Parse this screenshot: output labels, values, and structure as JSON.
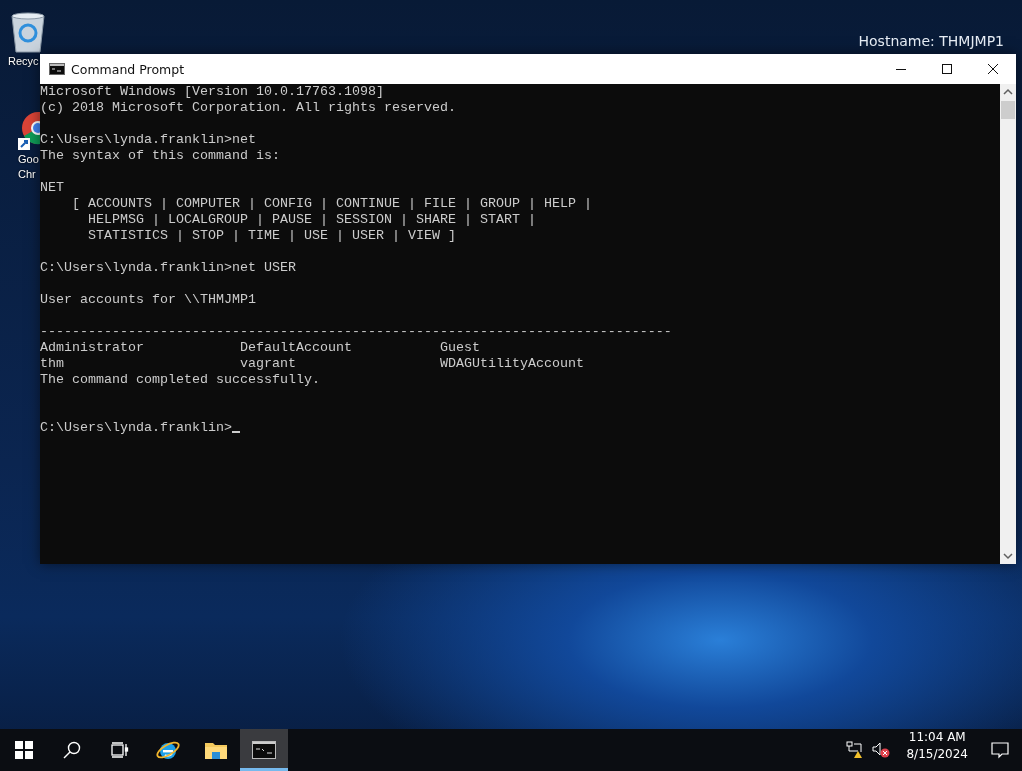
{
  "desktop": {
    "hostname": "Hostname: THMJMP1",
    "icons": [
      {
        "kind": "recycle",
        "label": "Recyc"
      },
      {
        "kind": "chrome",
        "label": "Goo",
        "label2": "Chr"
      }
    ]
  },
  "window": {
    "title": "Command Prompt",
    "blocks": [
      {
        "lines": [
          "Microsoft Windows [Version 10.0.17763.1098]",
          "(c) 2018 Microsoft Corporation. All rights reserved."
        ]
      },
      {
        "lines": [
          "C:\\Users\\lynda.franklin>net",
          "The syntax of this command is:"
        ]
      },
      {
        "lines": [
          "NET",
          "    [ ACCOUNTS | COMPUTER | CONFIG | CONTINUE | FILE | GROUP | HELP |",
          "      HELPMSG | LOCALGROUP | PAUSE | SESSION | SHARE | START |",
          "      STATISTICS | STOP | TIME | USE | USER | VIEW ]"
        ]
      },
      {
        "lines": [
          "C:\\Users\\lynda.franklin>net USER"
        ]
      },
      {
        "lines": [
          "User accounts for \\\\THMJMP1"
        ]
      },
      {
        "lines": [
          "-------------------------------------------------------------------------------",
          "Administrator            DefaultAccount           Guest",
          "thm                      vagrant                  WDAGUtilityAccount",
          "The command completed successfully."
        ]
      },
      {
        "double_gap": true,
        "cursor": true,
        "lines": [
          "C:\\Users\\lynda.franklin>"
        ]
      }
    ]
  },
  "taskbar": {
    "items": [
      {
        "kind": "start",
        "selected": false
      },
      {
        "kind": "search",
        "selected": false
      },
      {
        "kind": "taskview",
        "selected": false
      },
      {
        "kind": "ie",
        "selected": false
      },
      {
        "kind": "folder",
        "selected": false
      },
      {
        "kind": "cmd",
        "selected": true
      }
    ],
    "time": "11:04 AM",
    "date": "8/15/2024"
  }
}
